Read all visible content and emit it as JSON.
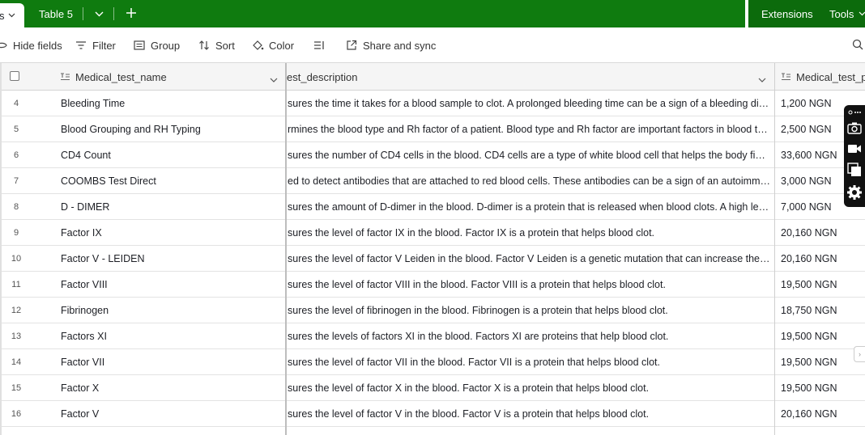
{
  "tabbar": {
    "left_tab_fragment": "s",
    "tab_name": "Table 5",
    "right": {
      "extensions": "Extensions",
      "tools": "Tools"
    }
  },
  "toolbar": {
    "hide_fields": "Hide fields",
    "filter": "Filter",
    "group": "Group",
    "sort": "Sort",
    "color": "Color",
    "share": "Share and sync"
  },
  "columns": {
    "name": "Medical_test_name",
    "description": "est_description",
    "price": "Medical_test_p"
  },
  "rows": [
    {
      "num": "4",
      "name": "Bleeding Time",
      "description": "sures the time it takes for a blood sample to clot. A prolonged bleeding time can be a sign of a bleeding disorder.",
      "price": "1,200 NGN"
    },
    {
      "num": "5",
      "name": "Blood Grouping and RH Typing",
      "description": "rmines the blood type and Rh factor of a patient. Blood type and Rh factor are important factors in blood transfusions.",
      "price": "2,500 NGN"
    },
    {
      "num": "6",
      "name": "CD4 Count",
      "description": "sures the number of CD4 cells in the blood. CD4 cells are a type of white blood cell that helps the body fight infection.",
      "price": "33,600 NGN"
    },
    {
      "num": "7",
      "name": "COOMBS Test Direct",
      "description": "ed to detect antibodies that are attached to red blood cells. These antibodies can be a sign of an autoimmune disorder.",
      "price": "3,000 NGN"
    },
    {
      "num": "8",
      "name": "D - DIMER",
      "description": "sures the amount of D-dimer in the blood. D-dimer is a protein that is released when blood clots. A high level may indicate a clot.",
      "price": "7,000 NGN"
    },
    {
      "num": "9",
      "name": "Factor IX",
      "description": "sures the level of factor IX in the blood. Factor IX is a protein that helps blood clot.",
      "price": "20,160 NGN"
    },
    {
      "num": "10",
      "name": "Factor V - LEIDEN",
      "description": "sures the level of factor V Leiden in the blood. Factor V Leiden is a genetic mutation that can increase the risk of clots.",
      "price": "20,160 NGN"
    },
    {
      "num": "11",
      "name": "Factor VIII",
      "description": "sures the level of factor VIII in the blood. Factor VIII is a protein that helps blood clot.",
      "price": "19,500 NGN"
    },
    {
      "num": "12",
      "name": "Fibrinogen",
      "description": "sures the level of fibrinogen in the blood. Fibrinogen is a protein that helps blood clot.",
      "price": "18,750 NGN"
    },
    {
      "num": "13",
      "name": "Factors XI",
      "description": "sures the levels of factors XI in the blood. Factors XI are proteins that help blood clot.",
      "price": "19,500 NGN"
    },
    {
      "num": "14",
      "name": "Factor VII",
      "description": "sures the level of factor VII in the blood. Factor VII is a protein that helps blood clot.",
      "price": "19,500 NGN"
    },
    {
      "num": "15",
      "name": "Factor X",
      "description": "sures the level of factor X in the blood. Factor X is a protein that helps blood clot.",
      "price": "19,500 NGN"
    },
    {
      "num": "16",
      "name": "Factor V",
      "description": "sures the level of factor V in the blood. Factor V is a protein that helps blood clot.",
      "price": "20,160 NGN"
    }
  ],
  "widget_icons": [
    "link-icon",
    "camera-icon",
    "video-icon",
    "copy-icon",
    "settings-icon"
  ],
  "colors": {
    "tabbar": "#0f7b0f",
    "header_bg": "#f5f5f5",
    "widget_bg": "#111111"
  }
}
